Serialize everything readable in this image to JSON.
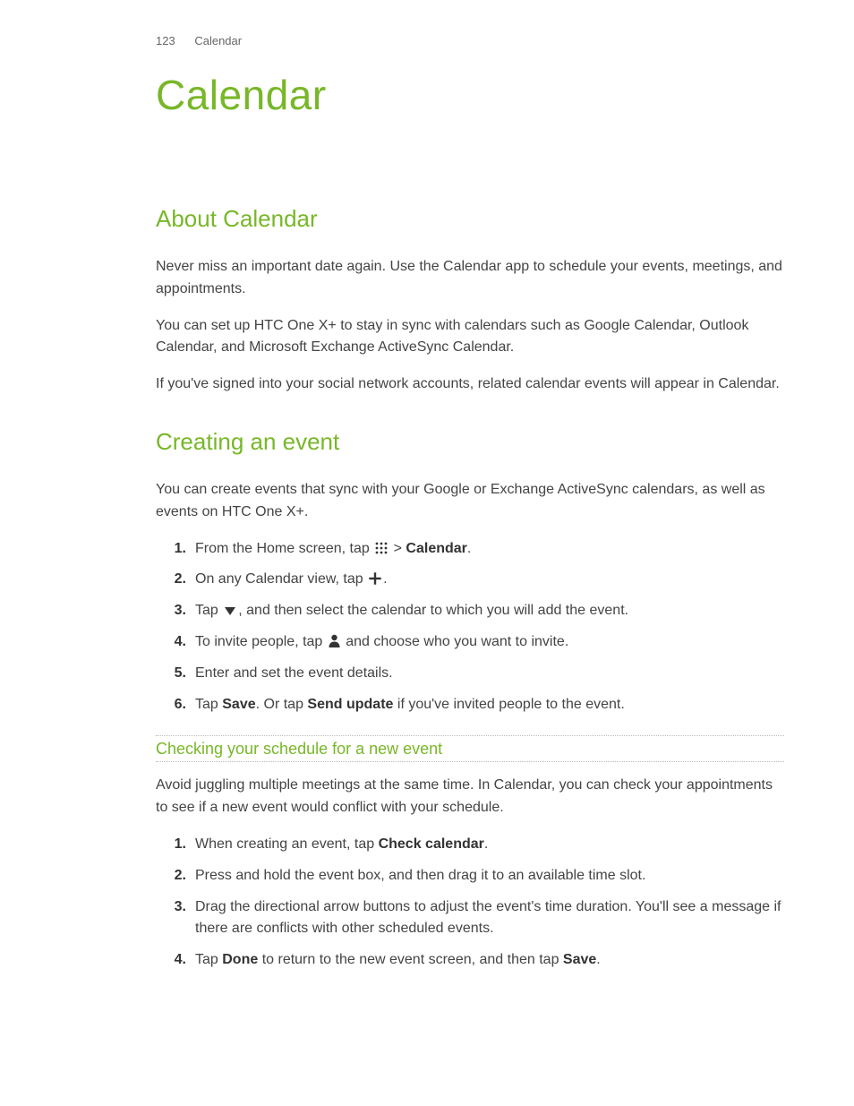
{
  "header": {
    "page_number": "123",
    "section_name": "Calendar"
  },
  "chapter_title": "Calendar",
  "sections": {
    "about": {
      "heading": "About Calendar",
      "p1": "Never miss an important date again. Use the Calendar app to schedule your events, meetings, and appointments.",
      "p2": "You can set up HTC One X+ to stay in sync with calendars such as Google Calendar, Outlook Calendar, and Microsoft Exchange ActiveSync Calendar.",
      "p3": "If you've signed into your social network accounts, related calendar events will appear in Calendar."
    },
    "creating": {
      "heading": "Creating an event",
      "intro": "You can create events that sync with your Google or Exchange ActiveSync calendars, as well as events on HTC One X+.",
      "step1_a": "From the Home screen, tap ",
      "step1_b": " > ",
      "step1_c": "Calendar",
      "step1_d": ".",
      "step2_a": "On any Calendar view, tap ",
      "step2_b": ".",
      "step3_a": "Tap ",
      "step3_b": ", and then select the calendar to which you will add the event.",
      "step4_a": "To invite people, tap ",
      "step4_b": " and choose who you want to invite.",
      "step5": "Enter and set the event details.",
      "step6_a": "Tap ",
      "step6_b": "Save",
      "step6_c": ". Or tap ",
      "step6_d": "Send update",
      "step6_e": " if you've invited people to the event."
    },
    "checking": {
      "heading": "Checking your schedule for a new event",
      "intro": "Avoid juggling multiple meetings at the same time. In Calendar, you can check your appointments to see if a new event would conflict with your schedule.",
      "step1_a": "When creating an event, tap ",
      "step1_b": "Check calendar",
      "step1_c": ".",
      "step2": "Press and hold the event box, and then drag it to an available time slot.",
      "step3": "Drag the directional arrow buttons to adjust the event's time duration. You'll see a message if there are conflicts with other scheduled events.",
      "step4_a": "Tap ",
      "step4_b": "Done",
      "step4_c": " to return to the new event screen, and then tap ",
      "step4_d": "Save",
      "step4_e": "."
    }
  }
}
